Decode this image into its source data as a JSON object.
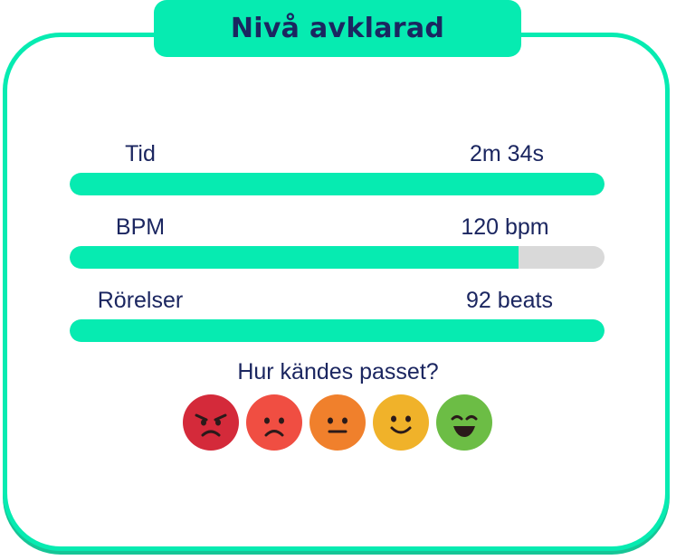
{
  "header": {
    "title": "Nivå avklarad"
  },
  "stats": [
    {
      "label": "Tid",
      "value": "2m 34s",
      "fill": 1.0
    },
    {
      "label": "BPM",
      "value": "120 bpm",
      "fill": 0.84
    },
    {
      "label": "Rörelser",
      "value": "92 beats",
      "fill": 1.0
    }
  ],
  "feedback": {
    "question": "Hur kändes passet?",
    "ratings": [
      {
        "icon": "angry-face-icon",
        "color": "#d42a3a"
      },
      {
        "icon": "sad-face-icon",
        "color": "#f04e42"
      },
      {
        "icon": "neutral-face-icon",
        "color": "#f0802c"
      },
      {
        "icon": "happy-face-icon",
        "color": "#f0b22a"
      },
      {
        "icon": "very-happy-face-icon",
        "color": "#6cbd45"
      }
    ]
  },
  "colors": {
    "accent": "#06ebb1",
    "text": "#1b2660",
    "track": "#d9d9d9"
  }
}
